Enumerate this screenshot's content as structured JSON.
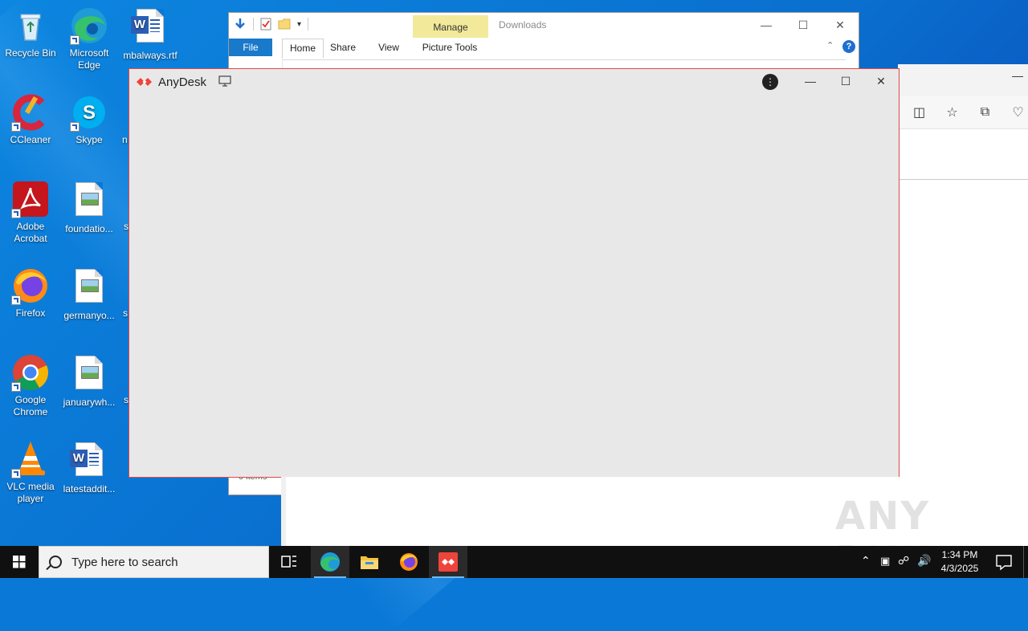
{
  "desktop": {
    "icons": [
      {
        "label": "Recycle Bin"
      },
      {
        "label": "Microsoft Edge"
      },
      {
        "label": "mbalways.rtf"
      },
      {
        "label": "CCleaner"
      },
      {
        "label": "Skype"
      },
      {
        "label": "Adobe Acrobat"
      },
      {
        "label": "foundatio..."
      },
      {
        "label": "Firefox"
      },
      {
        "label": "germanyo..."
      },
      {
        "label": "Google Chrome"
      },
      {
        "label": "januarywh..."
      },
      {
        "label": "VLC media player"
      },
      {
        "label": "latestaddit..."
      }
    ],
    "partial_labels": [
      "n",
      "s",
      "s",
      "s"
    ]
  },
  "explorer": {
    "title": "Downloads",
    "context_tab": "Manage",
    "context_group": "Picture Tools",
    "tabs": [
      "File",
      "Home",
      "Share",
      "View"
    ],
    "status": "0 items"
  },
  "anydesk": {
    "title": "AnyDesk"
  },
  "watermark": "ANY RUN",
  "taskbar": {
    "search_placeholder": "Type here to search",
    "time": "1:34 PM",
    "date": "4/3/2025"
  },
  "colors": {
    "desktop_bg": "#0a78d7",
    "anydesk_accent": "#e04848",
    "taskbar_bg": "#101010",
    "manage_tab": "#f2ea9a"
  }
}
